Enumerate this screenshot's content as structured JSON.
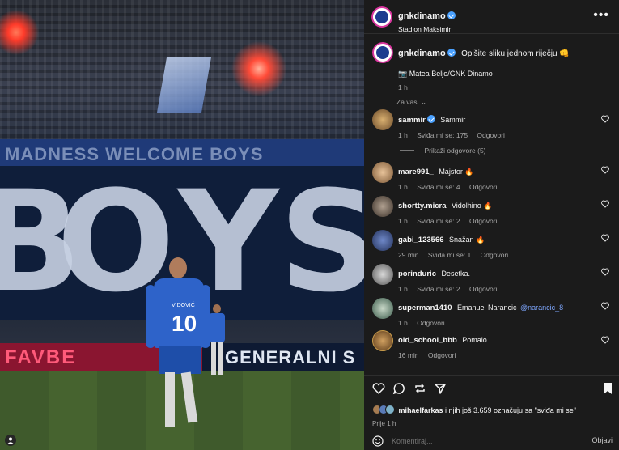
{
  "post": {
    "username": "gnkdinamo",
    "location": "Stadion Maksimir",
    "more_icon": "more-options-icon",
    "player_shirt_name": "VIDOVIĆ",
    "player_shirt_number": "10",
    "banner_text": "MADNESS   WELCOME   BOYS",
    "big_banner_letters": [
      "B",
      "O",
      "Y",
      "S"
    ],
    "ad_left_text": "FAVBE",
    "ad_right_text": "GENERALNI S"
  },
  "caption": {
    "username": "gnkdinamo",
    "text": "Opišite sliku jednom riječju 👊",
    "credit": "📷 Matea Beljo/GNK Dinamo",
    "time": "1 h"
  },
  "filter": {
    "label": "Za vas"
  },
  "comments": [
    {
      "username": "sammir",
      "verified": true,
      "text": "Sammir",
      "time": "1 h",
      "likes": "Sviđa mi se: 175",
      "reply": "Odgovori",
      "emoji": ""
    },
    {
      "username": "mare991_",
      "verified": false,
      "text": "Majstor 🔥",
      "time": "1 h",
      "likes": "Sviđa mi se: 4",
      "reply": "Odgovori"
    },
    {
      "username": "shortty.micra",
      "verified": false,
      "text": "Vidolhino 🔥",
      "time": "1 h",
      "likes": "Sviđa mi se: 2",
      "reply": "Odgovori"
    },
    {
      "username": "gabi_123566",
      "verified": false,
      "text": "Snažan 🔥",
      "time": "29 min",
      "likes": "Sviđa mi se: 1",
      "reply": "Odgovori"
    },
    {
      "username": "porinduric",
      "verified": false,
      "text": "Desetka.",
      "time": "1 h",
      "likes": "Sviđa mi se: 2",
      "reply": "Odgovori"
    },
    {
      "username": "superman1410",
      "verified": false,
      "text": "Emanuel Narancic",
      "mention": "@narancic_8",
      "time": "1 h",
      "likes": "",
      "reply": "Odgovori"
    },
    {
      "username": "old_school_bbb",
      "verified": false,
      "text": "Pomalo",
      "time": "16 min",
      "likes": "",
      "reply": "Odgovori"
    }
  ],
  "replies_toggle": "Prikaži odgovore (5)",
  "likes_summary": {
    "user": "mihaelfarkas",
    "text": " i njih još 3.659 označuju sa \"sviđa mi se\""
  },
  "post_time": "Prije 1 h",
  "comment_input": {
    "placeholder": "Komentiraj...",
    "submit": "Objavi"
  },
  "colors": {
    "panel_bg": "#1b1b1b",
    "verified_blue": "#4aa1ff",
    "mention_blue": "#7ea7ff",
    "muted": "#a8a8a8"
  }
}
